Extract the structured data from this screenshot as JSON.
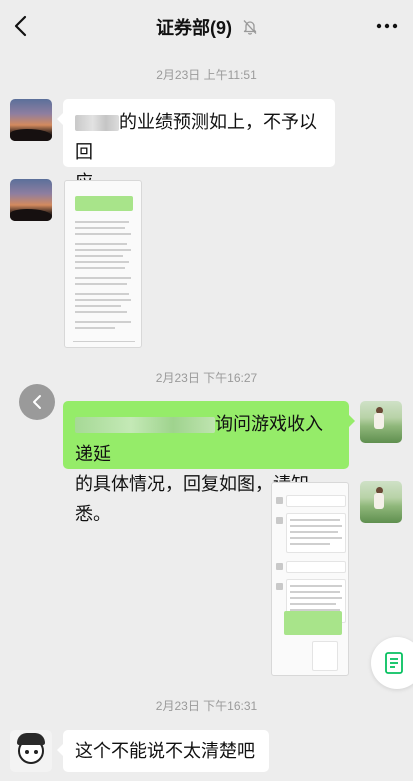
{
  "header": {
    "title": "证券部(9)",
    "back_icon": "chevron-left-icon",
    "mute_icon": "bell-muted-icon",
    "more_icon": "more-dots-icon"
  },
  "timestamps": {
    "t1": "2月23日 上午11:51",
    "t2": "2月23日 下午16:27",
    "t3": "2月23日 下午16:31"
  },
  "messages": {
    "m1_line1_suffix": "的业绩预测如上，不予以回",
    "m1_line2": "应。",
    "m3_line1_suffix": "询问游戏收入递延",
    "m3_line2": "的具体情况，回复如图，请知悉。",
    "m5": "这个不能说不太清楚吧"
  },
  "colors": {
    "background": "#ededed",
    "own_bubble": "#95ec69",
    "other_bubble": "#ffffff",
    "timestamp": "#9a9a9a"
  },
  "floating": {
    "back_icon": "chevron-left-icon",
    "doc_icon": "document-icon"
  }
}
